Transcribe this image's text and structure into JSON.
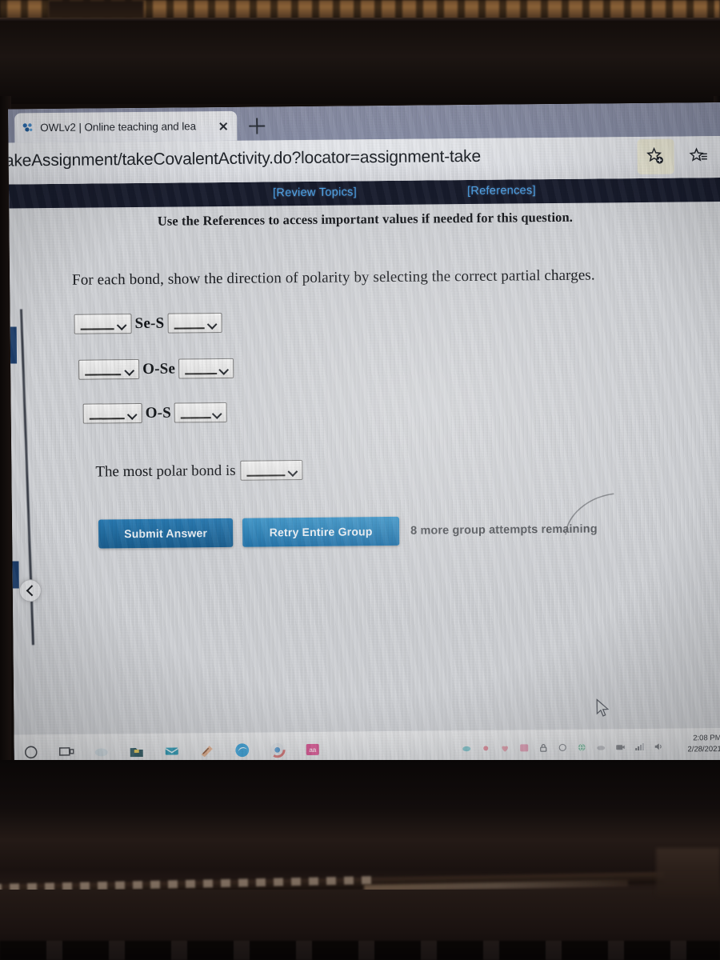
{
  "browser": {
    "tab": {
      "title": "OWLv2 | Online teaching and lea",
      "favicon_icon": "owl-favicon-icon",
      "close_icon": "close-icon"
    },
    "new_tab_icon": "plus-icon",
    "url": "/takeAssignment/takeCovalentActivity.do?locator=assignment-take",
    "toolbar": {
      "add_favorite_icon": "star-plus-icon",
      "favorites_list_icon": "star-list-icon"
    }
  },
  "owl": {
    "links": {
      "review_topics": "[Review Topics]",
      "references": "[References]"
    },
    "reference_note": "Use the References to access important values if needed for this question.",
    "question": "For each bond, show the direction of polarity by selecting the correct partial charges.",
    "placeholder": "",
    "bonds": [
      {
        "left_value": "",
        "label": "Se-S",
        "right_value": ""
      },
      {
        "left_value": "",
        "label": "O-Se",
        "right_value": ""
      },
      {
        "left_value": "",
        "label": "O-S",
        "right_value": ""
      }
    ],
    "most_polar": {
      "prompt": "The most polar bond is",
      "value": ""
    },
    "buttons": {
      "submit": "Submit Answer",
      "retry": "Retry Entire Group"
    },
    "attempts": "8 more group attempts remaining",
    "back_icon": "chevron-left-icon",
    "cursor_icon": "mouse-pointer-icon"
  },
  "taskbar": {
    "icons": [
      "search-circle-icon",
      "task-view-icon",
      "weather-icon",
      "file-explorer-icon",
      "mail-icon",
      "pen-icon",
      "edge-icon",
      "chrome-icon",
      "app-pink-icon"
    ],
    "tray": [
      "onedrive-icon",
      "dot-red-icon",
      "heart-icon",
      "photos-icon",
      "lock-icon",
      "sync-icon",
      "globe-icon",
      "cloud-icon",
      "camera-icon",
      "network-icon",
      "volume-icon"
    ],
    "clock_time": "2:08 PM",
    "clock_date": "2/28/2021"
  },
  "colors": {
    "owl_topbar": "#171b2c",
    "owl_link": "#4da3e8",
    "submit_button": "#1a5f91",
    "retry_button": "#2073ab",
    "tabstrip": "#8a90a9",
    "page_bg": "#d2d4d8"
  }
}
